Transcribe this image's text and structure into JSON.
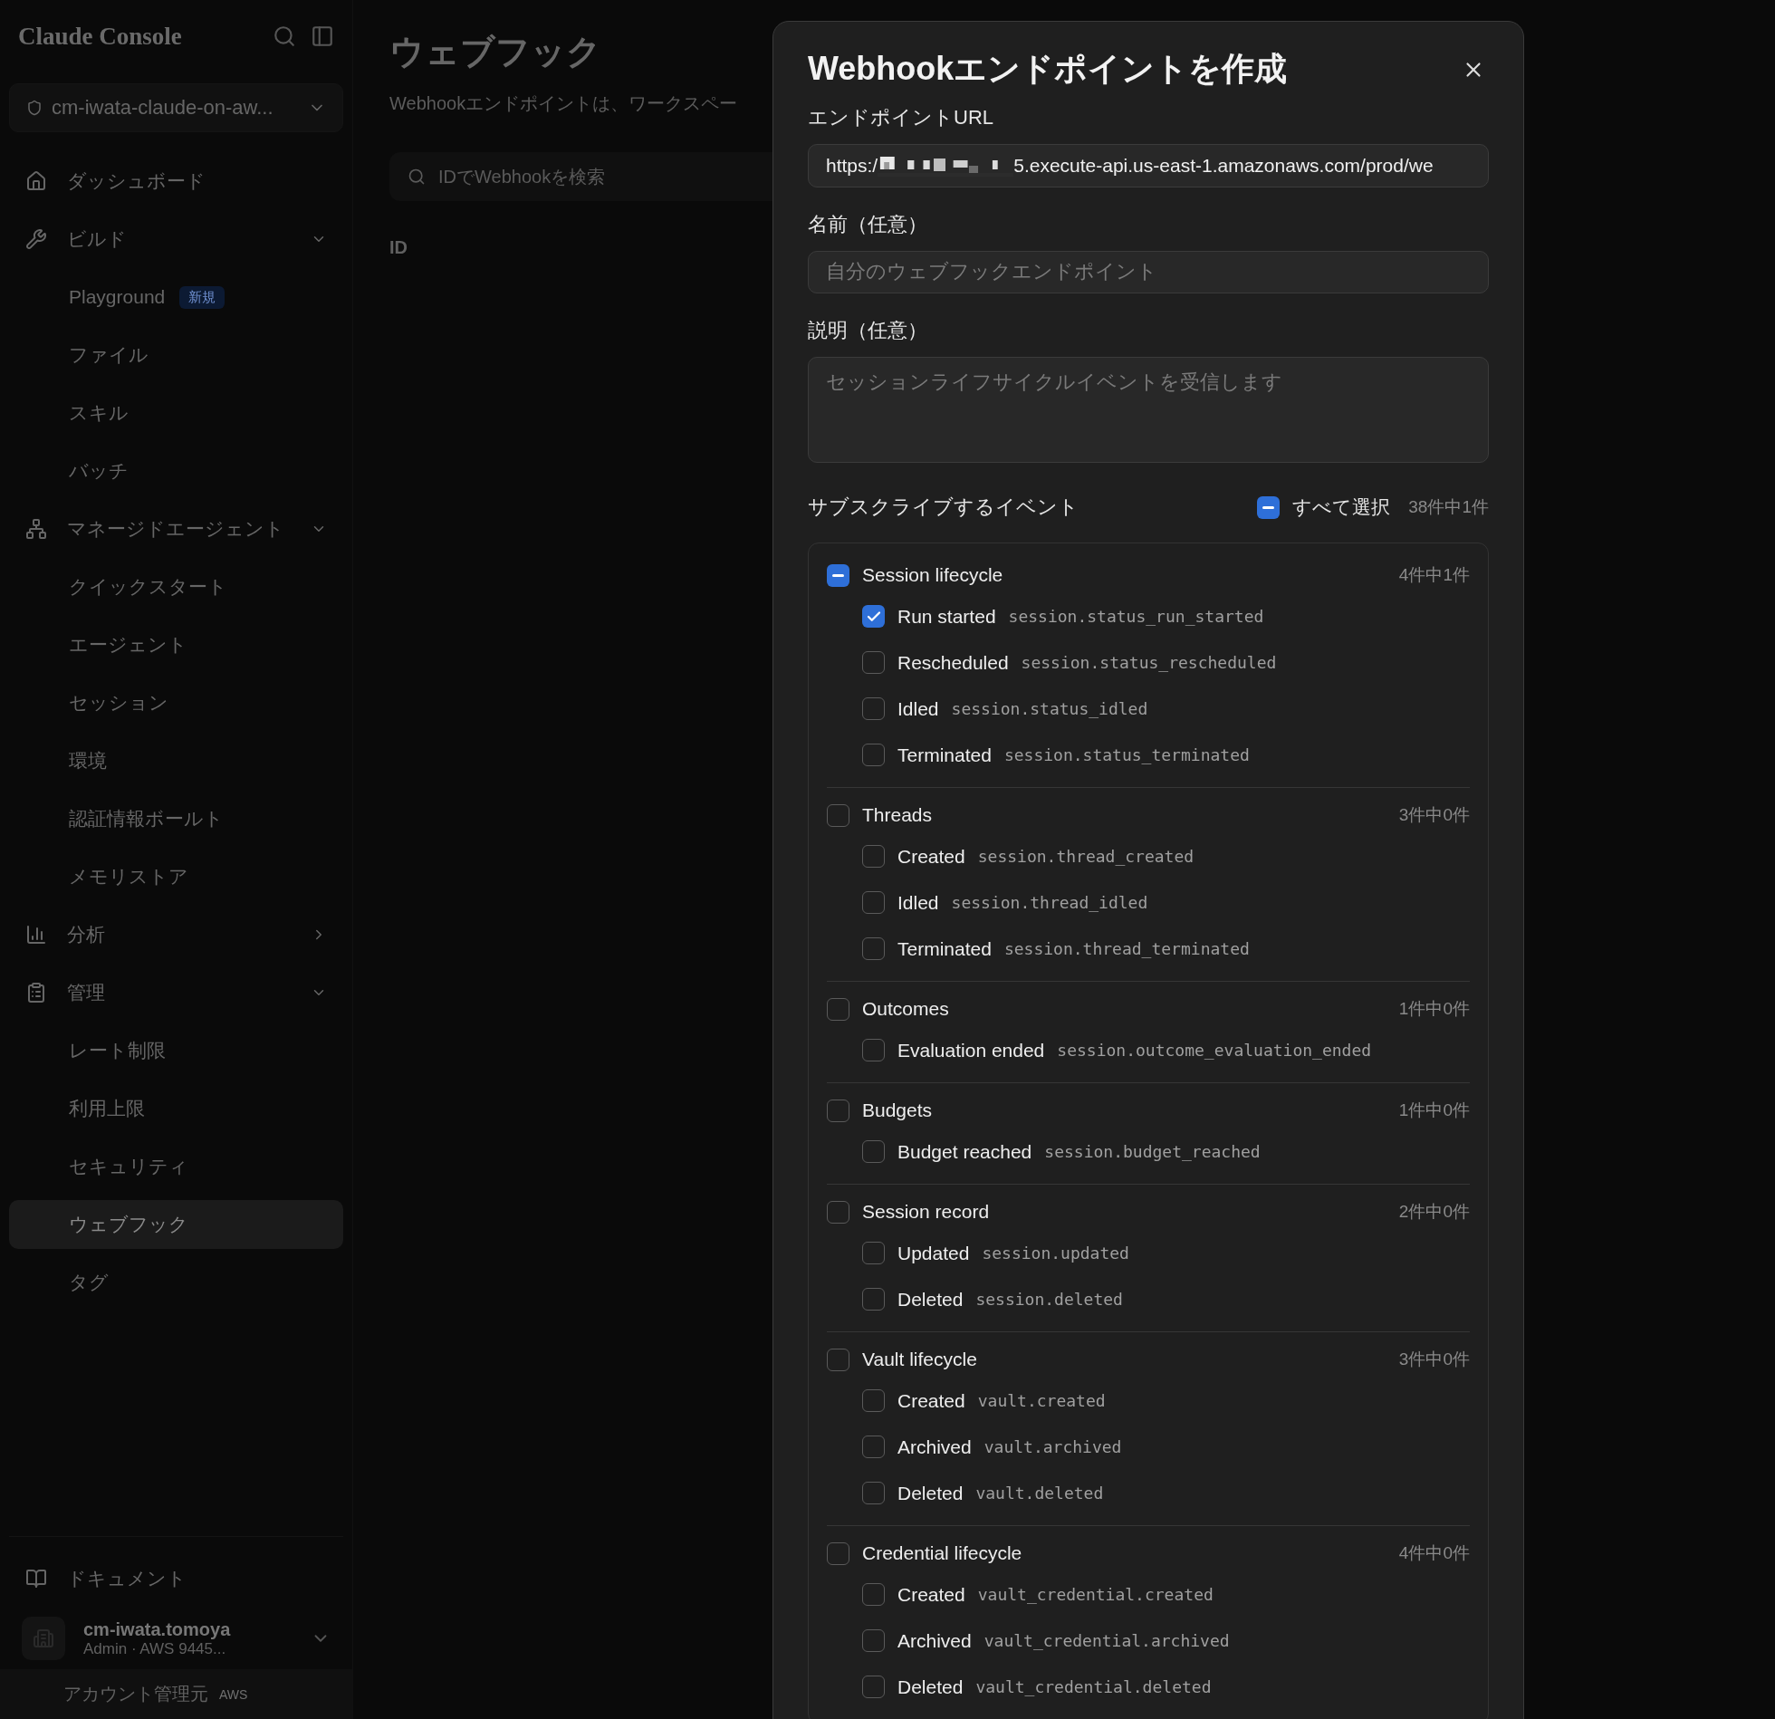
{
  "sidebar": {
    "logo": "Claude Console",
    "workspace": "cm-iwata-claude-on-aw...",
    "nav": [
      {
        "label": "ダッシュボード",
        "selected": false
      },
      {
        "label": "ビルド",
        "selected": false,
        "expanded": true,
        "children": [
          {
            "label": "Playground",
            "badge": "新規",
            "selected": false
          },
          {
            "label": "ファイル",
            "selected": false
          },
          {
            "label": "スキル",
            "selected": false
          },
          {
            "label": "バッチ",
            "selected": false
          }
        ]
      },
      {
        "label": "マネージドエージェント",
        "selected": false,
        "expanded": true,
        "children": [
          {
            "label": "クイックスタート",
            "selected": false
          },
          {
            "label": "エージェント",
            "selected": false
          },
          {
            "label": "セッション",
            "selected": false
          },
          {
            "label": "環境",
            "selected": false
          },
          {
            "label": "認証情報ボールト",
            "selected": false
          },
          {
            "label": "メモリストア",
            "selected": false
          }
        ]
      },
      {
        "label": "分析",
        "selected": false,
        "expanded": false
      },
      {
        "label": "管理",
        "selected": false,
        "expanded": true,
        "children": [
          {
            "label": "レート制限",
            "selected": false
          },
          {
            "label": "利用上限",
            "selected": false
          },
          {
            "label": "セキュリティ",
            "selected": false
          },
          {
            "label": "ウェブフック",
            "selected": true
          },
          {
            "label": "タグ",
            "selected": false
          }
        ]
      }
    ],
    "docs": "ドキュメント",
    "user": {
      "name": "cm-iwata.tomoya",
      "detail": "Admin · AWS 9445..."
    },
    "account": {
      "label": "アカウント管理元",
      "badge": "AWS"
    }
  },
  "main": {
    "title": "ウェブフック",
    "description": "Webhookエンドポイントは、ワークスペー",
    "search": {
      "placeholder": "IDでWebhookを検索"
    },
    "columns": [
      "ID"
    ]
  },
  "modal": {
    "title": "Webhookエンドポイントを作成",
    "url": {
      "label": "エンドポイントURL",
      "value_start": "https:/",
      "value_end": "5.execute-api.us-east-1.amazonaws.com/prod/we"
    },
    "name": {
      "label": "名前（任意）",
      "placeholder": "自分のウェブフックエンドポイント"
    },
    "description": {
      "label": "説明（任意）",
      "placeholder": "セッションライフサイクルイベントを受信します"
    },
    "events": {
      "label": "サブスクライブするイベント",
      "select_all": {
        "label": "すべて選択",
        "indeterminate": true
      },
      "count": "38件中1件",
      "groups": [
        {
          "label": "Session lifecycle",
          "indeterminate": true,
          "count": "4件中1件",
          "events": [
            {
              "label": "Run started",
              "code": "session.status_run_started",
              "checked": true
            },
            {
              "label": "Rescheduled",
              "code": "session.status_rescheduled",
              "checked": false
            },
            {
              "label": "Idled",
              "code": "session.status_idled",
              "checked": false
            },
            {
              "label": "Terminated",
              "code": "session.status_terminated",
              "checked": false
            }
          ]
        },
        {
          "label": "Threads",
          "indeterminate": false,
          "count": "3件中0件",
          "events": [
            {
              "label": "Created",
              "code": "session.thread_created",
              "checked": false
            },
            {
              "label": "Idled",
              "code": "session.thread_idled",
              "checked": false
            },
            {
              "label": "Terminated",
              "code": "session.thread_terminated",
              "checked": false
            }
          ]
        },
        {
          "label": "Outcomes",
          "indeterminate": false,
          "count": "1件中0件",
          "events": [
            {
              "label": "Evaluation ended",
              "code": "session.outcome_evaluation_ended",
              "checked": false
            }
          ]
        },
        {
          "label": "Budgets",
          "indeterminate": false,
          "count": "1件中0件",
          "events": [
            {
              "label": "Budget reached",
              "code": "session.budget_reached",
              "checked": false
            }
          ]
        },
        {
          "label": "Session record",
          "indeterminate": false,
          "count": "2件中0件",
          "events": [
            {
              "label": "Updated",
              "code": "session.updated",
              "checked": false
            },
            {
              "label": "Deleted",
              "code": "session.deleted",
              "checked": false
            }
          ]
        },
        {
          "label": "Vault lifecycle",
          "indeterminate": false,
          "count": "3件中0件",
          "events": [
            {
              "label": "Created",
              "code": "vault.created",
              "checked": false
            },
            {
              "label": "Archived",
              "code": "vault.archived",
              "checked": false
            },
            {
              "label": "Deleted",
              "code": "vault.deleted",
              "checked": false
            }
          ]
        },
        {
          "label": "Credential lifecycle",
          "indeterminate": false,
          "count": "4件中0件",
          "events": [
            {
              "label": "Created",
              "code": "vault_credential.created",
              "checked": false
            },
            {
              "label": "Archived",
              "code": "vault_credential.archived",
              "checked": false
            },
            {
              "label": "Deleted",
              "code": "vault_credential.deleted",
              "checked": false
            }
          ]
        }
      ]
    }
  }
}
